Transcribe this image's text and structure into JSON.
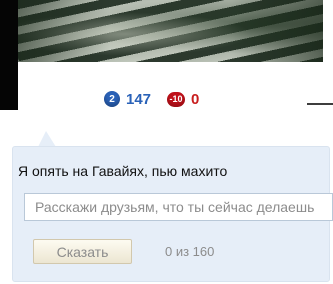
{
  "stats": {
    "blue_badge": "2",
    "blue_value": "147",
    "red_badge": "-10",
    "red_value": "0"
  },
  "status": {
    "current_text": "Я опять на Гавайях, пью махито",
    "input_placeholder": "Расскажи друзьям, что ты сейчас делаешь",
    "say_button": "Сказать",
    "char_counter": "0 из 160"
  },
  "colors": {
    "blue": "#2a62b8",
    "red": "#c81d1d",
    "box_bg": "#e6eef8"
  }
}
